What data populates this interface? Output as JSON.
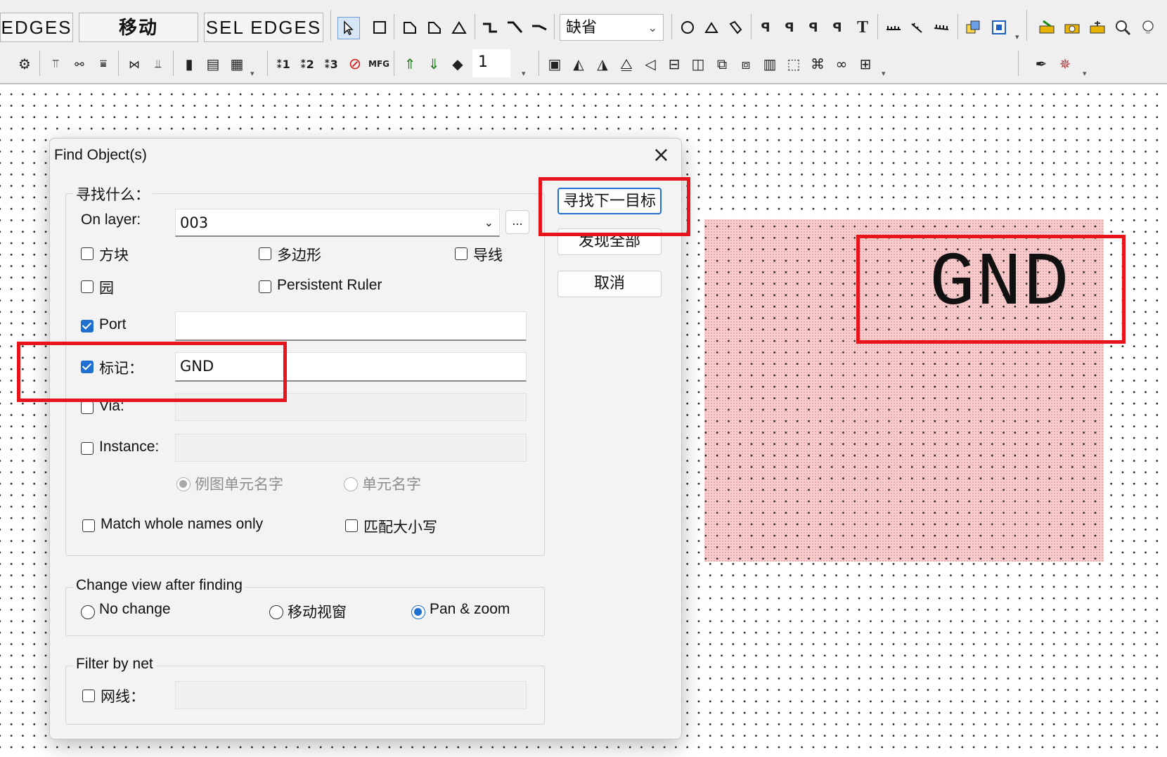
{
  "toolbar": {
    "tab_edges": "EDGES",
    "tab_move": "移动",
    "tab_sel_edges": "SEL EDGES",
    "style_dropdown": "缺省",
    "layer_number": "1"
  },
  "canvas": {
    "label_text": "GND",
    "highlight_color": "#e8141b",
    "region_color": "#f6cccc"
  },
  "dialog": {
    "title": "Find Object(s)",
    "close_icon": "×",
    "group_find_what": "寻找什么：",
    "on_layer_label": "On layer:",
    "on_layer_value": "003",
    "browse_button": "...",
    "cb_square": "方块",
    "cb_polygon": "多边形",
    "cb_wire": "导线",
    "cb_circle": "园",
    "cb_persistent_ruler": "Persistent Ruler",
    "port_label": "Port",
    "port_checked": true,
    "port_value": "",
    "mark_label": "标记：",
    "mark_checked": true,
    "mark_value": "GND",
    "via_label": "Via:",
    "via_value": "",
    "instance_label": "Instance:",
    "instance_value": "",
    "radio_instance_name": "例图单元名字",
    "radio_cell_name": "单元名字",
    "match_whole": "Match whole names only",
    "match_case": "匹配大小写",
    "group_change_view": "Change view after finding",
    "view_no_change": "No change",
    "view_move_window": "移动视窗",
    "view_pan_zoom": "Pan & zoom",
    "view_selected": "Pan & zoom",
    "group_filter_net": "Filter by net",
    "net_label": "网线：",
    "net_value": "",
    "btn_find_next": "寻找下一目标",
    "btn_find_all": "发现全部",
    "btn_cancel": "取消"
  }
}
